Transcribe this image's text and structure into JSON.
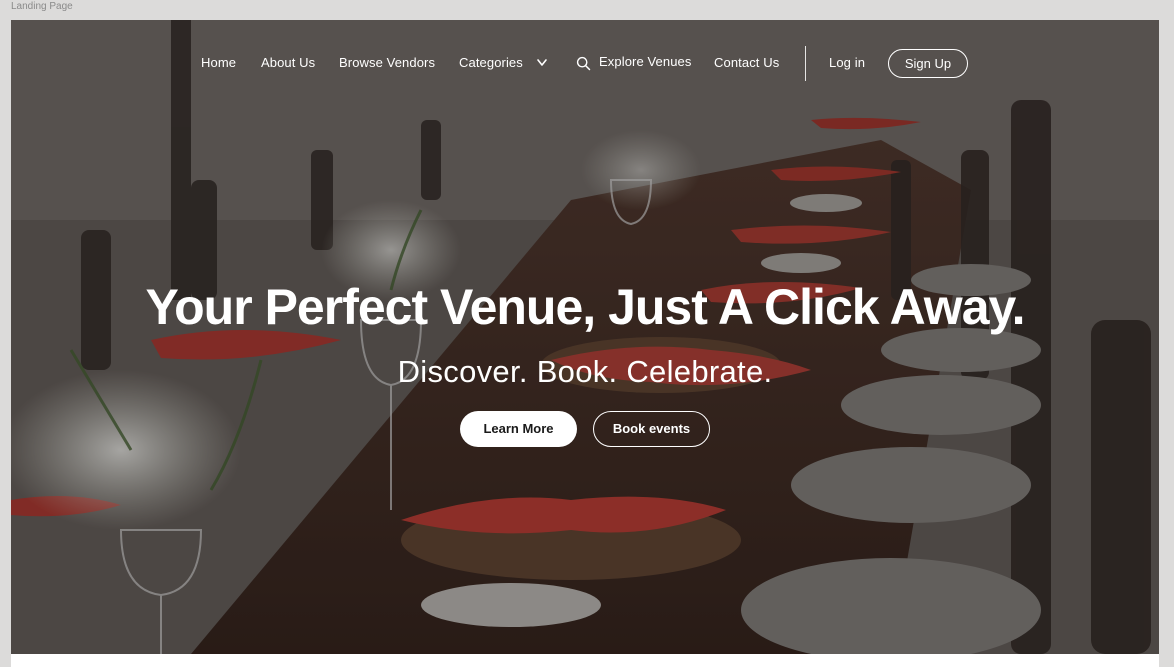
{
  "frame": {
    "label": "Landing Page"
  },
  "nav": {
    "home": "Home",
    "about": "About Us",
    "browse_vendors": "Browse Vendors",
    "categories": "Categories",
    "explore_venues": "Explore Venues",
    "contact": "Contact Us",
    "login": "Log in",
    "signup": "Sign Up"
  },
  "hero": {
    "headline": "Your Perfect Venue, Just A Click Away.",
    "subheadline": "Discover. Book. Celebrate.",
    "primary_button": "Learn More",
    "secondary_button": "Book events",
    "image": "banquet-table-photo"
  },
  "colors": {
    "text": "#ffffff",
    "frame_background": "#dcdbda",
    "accent_napkin": "#b8362e"
  },
  "icons": {
    "categories": "chevron-down-icon",
    "explore": "search-icon"
  }
}
